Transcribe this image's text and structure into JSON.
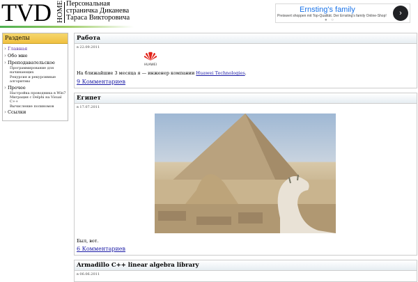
{
  "header": {
    "logo": "TVD",
    "logo_home": "HOME",
    "site_title": "Персональная страничка Диканева Тараса Викторовича"
  },
  "ad": {
    "title": "Ernsting's family",
    "text": "Preiswert shoppen mit Top-Qualität. Der Ernsting's family Online-Shop!",
    "arrow": "›"
  },
  "sidebar": {
    "heading": "Разделы",
    "items": [
      {
        "label": "Главная",
        "type": "item",
        "active": true
      },
      {
        "label": "Обо мне",
        "type": "item"
      },
      {
        "label": "Преподавательское",
        "type": "item"
      },
      {
        "label": "Программирование для начинающих",
        "type": "sub"
      },
      {
        "label": "Рекурсия и рекурсивные алгоритмы",
        "type": "sub"
      },
      {
        "label": "Прочее",
        "type": "item"
      },
      {
        "label": "Настройка проводника в Win7",
        "type": "sub"
      },
      {
        "label": "Миграция с Delphi на Visual C++",
        "type": "sub"
      },
      {
        "label": "Вычисление полиномов",
        "type": "sub"
      },
      {
        "label": "Ссылки",
        "type": "item"
      }
    ]
  },
  "posts": [
    {
      "title": "Работа",
      "date": "в 22.09.2011",
      "logo_text": "HUAWEI",
      "text_before": "На ближайшие 3 месяца я — инженер компании ",
      "link": "Huawei Technologies",
      "text_after": ".",
      "comments": "9 Комментариев"
    },
    {
      "title": "Египет",
      "date": "в 17.07.2011",
      "text": "Был, вот.",
      "comments": "6 Комментариев"
    },
    {
      "title": "Armadillo C++ linear algebra library",
      "date": "в 06.06.2011"
    }
  ]
}
